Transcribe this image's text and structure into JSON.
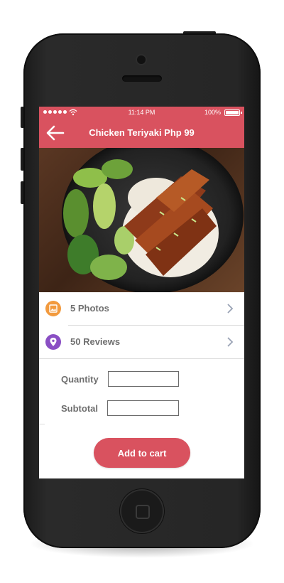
{
  "status_bar": {
    "time": "11:14 PM",
    "battery": "100%"
  },
  "header": {
    "title": "Chicken Teriyaki Php 99",
    "back_icon": "arrow-left-icon"
  },
  "hero_image": {
    "subject": "chicken-teriyaki-rice-bok-choy"
  },
  "info_rows": [
    {
      "label": "5 Photos",
      "icon": "image-icon",
      "icon_color": "#f29a3e"
    },
    {
      "label": "50 Reviews",
      "icon": "location-pin-icon",
      "icon_color": "#8a4fc4"
    }
  ],
  "form": {
    "quantity_label": "Quantity",
    "quantity_value": "",
    "subtotal_label": "Subtotal",
    "subtotal_value": ""
  },
  "cart_button": {
    "label": "Add to cart"
  },
  "colors": {
    "accent": "#d9525f",
    "label_text": "#6f6f6f",
    "phone_body": "#262626"
  }
}
